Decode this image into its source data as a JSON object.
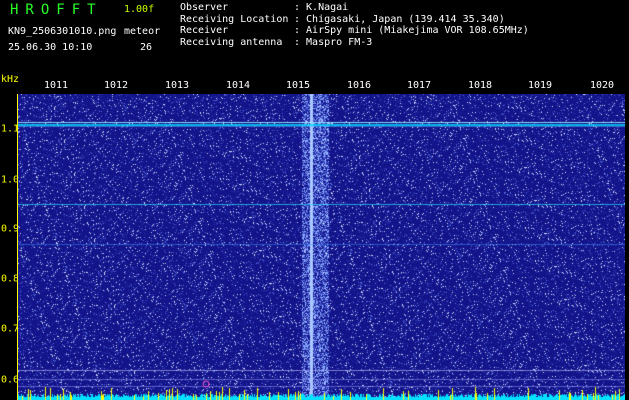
{
  "header": {
    "app_name": "HROFFT",
    "version": "1.00f",
    "filename": "KN9_2506301010.png",
    "meteor_label": "meteor",
    "datetime": "25.06.30 10:10",
    "meteor_count": "26"
  },
  "info": [
    {
      "key": "Observer",
      "value": ": K.Nagai"
    },
    {
      "key": "Receiving Location",
      "value": ": Chigasaki, Japan (139.414 35.340)"
    },
    {
      "key": "Receiver",
      "value": ": AirSpy mini (Miakejima VOR 108.65MHz)"
    },
    {
      "key": "Receiving antenna",
      "value": ": Maspro FM-3"
    }
  ],
  "axis": {
    "y_unit": "kHz",
    "freq_ticks": [
      "1011",
      "1012",
      "1013",
      "1014",
      "1015",
      "1016",
      "1017",
      "1018",
      "1019",
      "1020"
    ],
    "y_ticks": [
      "1.1",
      "1.0",
      "0.9",
      "0.8",
      "0.7",
      "0.6"
    ]
  },
  "colors": {
    "background": "#13148a",
    "noise": "#ffffff",
    "accent": "#ffff00",
    "signal": "#00e0ff",
    "title": "#28ff28"
  }
}
